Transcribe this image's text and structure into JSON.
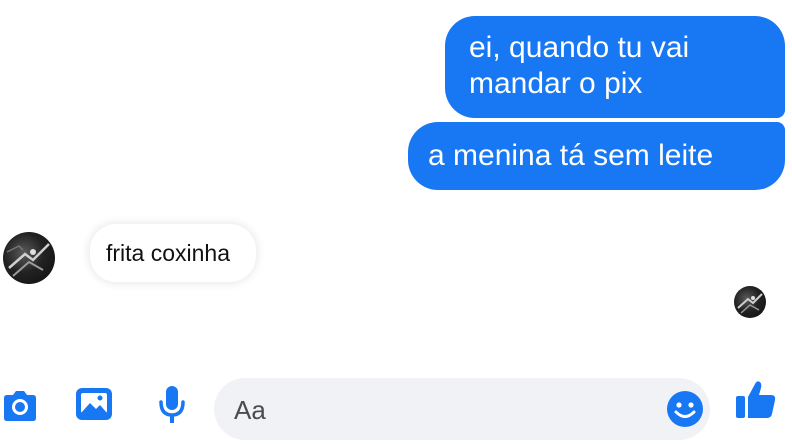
{
  "colors": {
    "accent": "#1877f2",
    "outgoing_bubble": "#1877f2",
    "incoming_bubble": "#ffffff",
    "composer_bg": "#f0f2f5"
  },
  "messages": {
    "outgoing": [
      {
        "text": "ei, quando tu vai\nmandar o pix"
      },
      {
        "text": "a menina tá sem leite"
      }
    ],
    "incoming": [
      {
        "text": "frita coxinha"
      }
    ]
  },
  "composer": {
    "placeholder": "Aa"
  },
  "toolbar": {
    "icons": [
      "camera-icon",
      "image-icon",
      "microphone-icon",
      "emoji-icon",
      "thumbs-up-icon"
    ]
  }
}
